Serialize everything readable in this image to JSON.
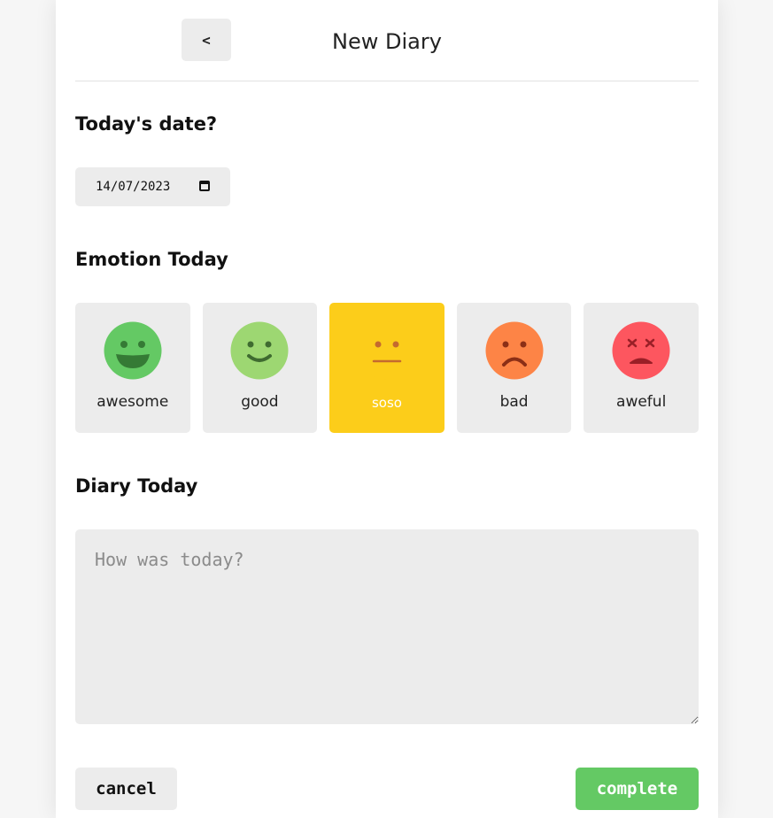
{
  "header": {
    "back_label": "<",
    "title": "New Diary"
  },
  "date_section": {
    "title": "Today's date?",
    "value": "14/07/2023"
  },
  "emotion_section": {
    "title": "Emotion Today",
    "selected": "soso",
    "items": [
      {
        "label": "awesome",
        "icon": "awesome-emotion-icon",
        "color": "#64c964"
      },
      {
        "label": "good",
        "icon": "good-emotion-icon",
        "color": "#9dd772"
      },
      {
        "label": "soso",
        "icon": "soso-emotion-icon",
        "color": "#fccd1a"
      },
      {
        "label": "bad",
        "icon": "bad-emotion-icon",
        "color": "#fd8446"
      },
      {
        "label": "aweful",
        "icon": "aweful-emotion-icon",
        "color": "#fd565f"
      }
    ]
  },
  "diary_section": {
    "title": "Diary Today",
    "placeholder": "How was today?",
    "value": ""
  },
  "actions": {
    "cancel_label": "cancel",
    "complete_label": "complete"
  },
  "colors": {
    "accent": "#64c964",
    "selected": "#fccd1a",
    "surface": "#ececec"
  }
}
